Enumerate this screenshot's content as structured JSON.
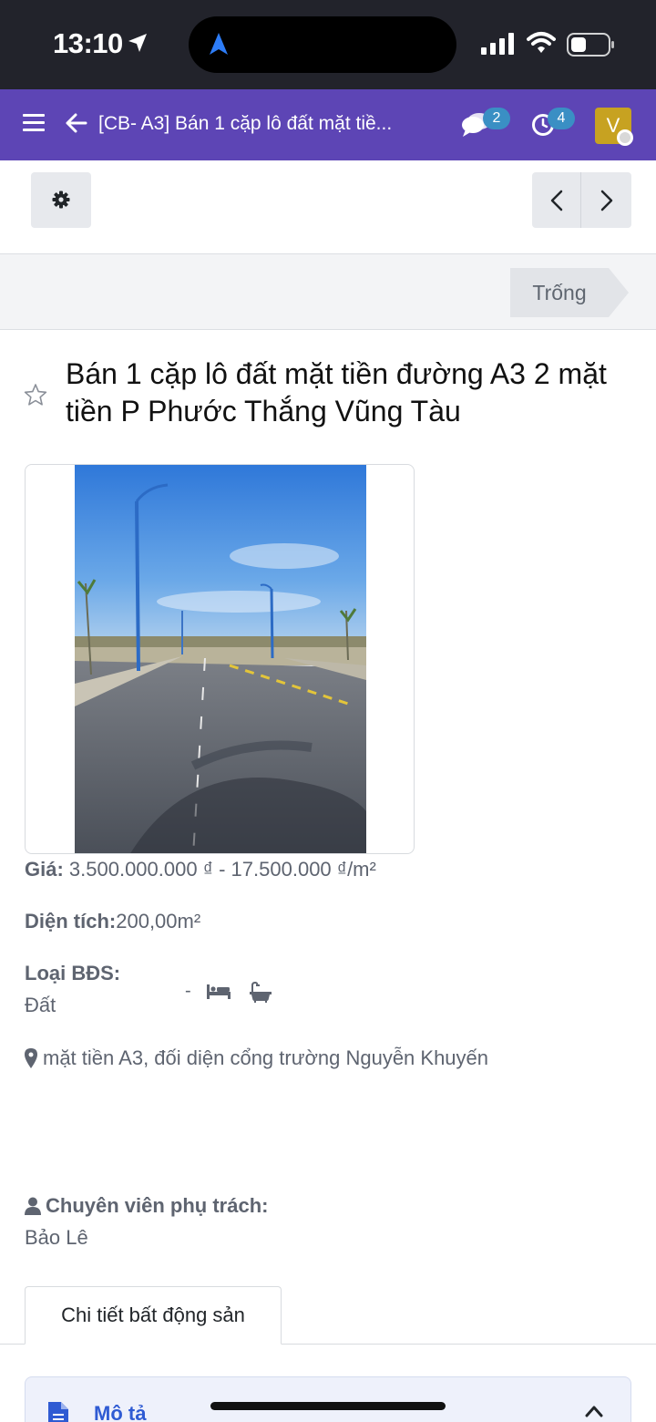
{
  "status_bar": {
    "time": "13:10"
  },
  "nav": {
    "title": "[CB- A3] Bán 1 cặp lô đất mặt tiề...",
    "messages_badge": "2",
    "activities_badge": "4",
    "avatar_initial": "V"
  },
  "stage": {
    "label": "Trống"
  },
  "property": {
    "title": "Bán 1 cặp lô đất mặt tiền đường A3  2 mặt tiền P Phước Thắng Vũng Tàu",
    "price_label": "Giá:",
    "price_value": " 3.500.000.000 ₫ - 17.500.000 ₫/m²",
    "area_label": "Diện tích:",
    "area_value": "200,00m²",
    "type_label": "Loại BĐS:",
    "type_value": "Đất",
    "rooms_dash": "-",
    "address": "mặt tiền A3, đối diện cổng trường Nguyễn Khuyến",
    "agent_label": "Chuyên viên phụ trách:",
    "agent_name": "Bảo Lê"
  },
  "tabs": [
    {
      "label": "Chi tiết bất động sản"
    }
  ],
  "section": {
    "label": "Mô tả"
  },
  "colors": {
    "nav_bg": "#5d45b5",
    "avatar_bg": "#c7a221",
    "badge_bg": "#3a8fc4",
    "link": "#2f5bd3"
  }
}
